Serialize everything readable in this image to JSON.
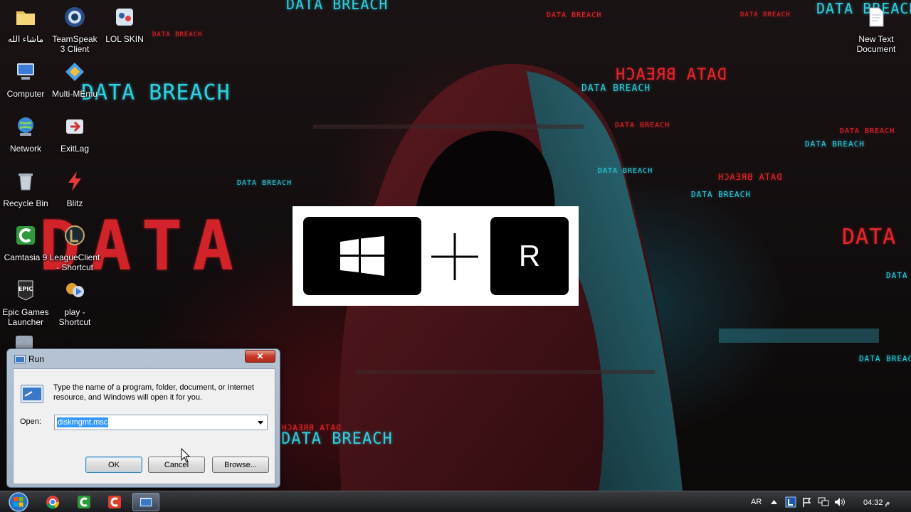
{
  "desktop": {
    "icons": [
      {
        "label": "ماشاء الله",
        "icon": "folder-icon"
      },
      {
        "label": "TeamSpeak 3 Client",
        "icon": "teamspeak-icon"
      },
      {
        "label": "LOL SKIN",
        "icon": "lol-skin-icon"
      },
      {
        "label": "Computer",
        "icon": "computer-icon"
      },
      {
        "label": "Multi-MEmu",
        "icon": "multi-memu-icon"
      },
      {
        "label": "Network",
        "icon": "network-icon"
      },
      {
        "label": "ExitLag",
        "icon": "exitlag-icon"
      },
      {
        "label": "Recycle Bin",
        "icon": "recycle-bin-icon"
      },
      {
        "label": "Blitz",
        "icon": "blitz-icon"
      },
      {
        "label": "Camtasia 9",
        "icon": "camtasia-icon"
      },
      {
        "label": "LeagueClient - Shortcut",
        "icon": "league-client-icon"
      },
      {
        "label": "Epic Games Launcher",
        "icon": "epic-games-icon"
      },
      {
        "label": "play - Shortcut",
        "icon": "play-shortcut-icon"
      },
      {
        "label": "New Text Document",
        "icon": "text-document-icon"
      }
    ]
  },
  "wallpaper": {
    "big_text": "DATA BREACH",
    "small_text": "DATA BREACH",
    "data_text": "DATA",
    "colors": {
      "cyan": "#2fd0e0",
      "red": "#e6262c"
    }
  },
  "shortcut_overlay": {
    "key1": "windows-logo-icon",
    "plus": "plus-icon",
    "key2_label": "R"
  },
  "run_dialog": {
    "title": "Run",
    "close_label": "✕",
    "description": "Type the name of a program, folder, document, or Internet resource, and Windows will open it for you.",
    "open_label": "Open:",
    "open_value": "diskmgmt.msc",
    "ok_label": "OK",
    "cancel_label": "Cancel",
    "browse_label": "Browse..."
  },
  "taskbar": {
    "pinned": [
      "chrome-icon",
      "camtasia-icon",
      "camtasia-recorder-icon",
      "run-icon"
    ],
    "language": "AR",
    "clock": "04:32 م"
  }
}
